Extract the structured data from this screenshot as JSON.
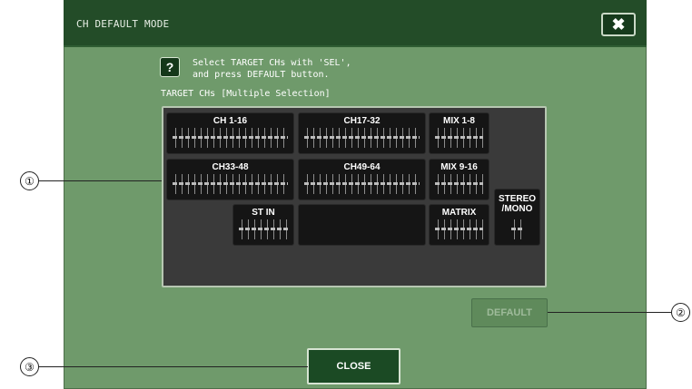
{
  "dialog": {
    "title": "CH DEFAULT MODE",
    "close_icon": "close-icon",
    "close_symbol": "✖"
  },
  "help": {
    "icon_symbol": "?",
    "instruction": "Select TARGET CHs with 'SEL',\nand press DEFAULT button."
  },
  "target_label": "TARGET CHs [Multiple Selection]",
  "channels": [
    {
      "label": "CH 1-16"
    },
    {
      "label": "CH17-32"
    },
    {
      "label": "MIX 1-8"
    },
    {
      "label": "CH33-48"
    },
    {
      "label": "CH49-64"
    },
    {
      "label": "MIX 9-16"
    },
    {
      "label": "ST IN"
    },
    {
      "label": "MATRIX"
    },
    {
      "label": "STEREO\n/MONO"
    }
  ],
  "buttons": {
    "default": "DEFAULT",
    "close": "CLOSE"
  },
  "callouts": [
    "①",
    "②",
    "③"
  ],
  "colors": {
    "dialog_bg": "#6f9a6b",
    "titlebar": "#234c28",
    "panel": "#3a3a3a",
    "button_dark": "#151515"
  }
}
